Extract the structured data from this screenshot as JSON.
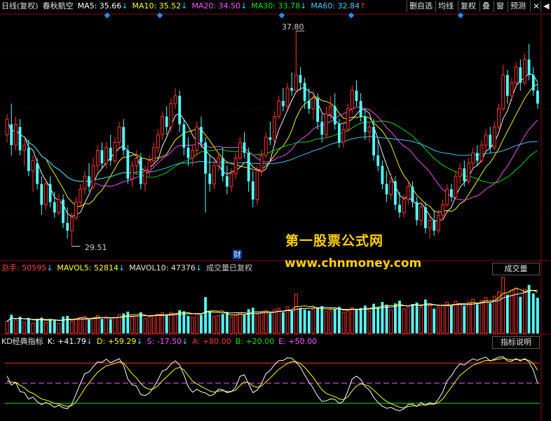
{
  "header": {
    "period": "日线(复权)",
    "stock_name": "春秋航空",
    "ma": [
      {
        "label": "MA5: 35.66",
        "arrow": "↓",
        "color": "#ffffff",
        "arrow_color": "#00d8ff"
      },
      {
        "label": "MA10: 35.52",
        "arrow": "↓",
        "color": "#ffff00",
        "arrow_color": "#00d8ff"
      },
      {
        "label": "MA20: 34.50",
        "arrow": "↓",
        "color": "#ff55ff",
        "arrow_color": "#00d8ff"
      },
      {
        "label": "MA30: 33.78",
        "arrow": "↓",
        "color": "#00e000",
        "arrow_color": "#00d8ff"
      },
      {
        "label": "MA60: 32.84",
        "arrow": "↑",
        "color": "#44ccff",
        "arrow_color": "#ff3030"
      }
    ],
    "toolbar": [
      "删自选",
      "均线",
      "复权",
      "叠",
      "窗",
      "预测"
    ],
    "close_icon": "close-icon",
    "back_icon": "arrow-left-icon"
  },
  "main_chart": {
    "high_label": "37.80",
    "low_label": "29.51",
    "event_marker": "财",
    "watermark_title": "第一股票公式网",
    "watermark_url": "www.chnmoney.com"
  },
  "volume_panel": {
    "total_label": "总手: 50595",
    "total_arrow": "↓",
    "mavol5": "MAVOL5: 52814",
    "mavol5_arrow": "↓",
    "mavol10": "MAVOL10: 47376",
    "mavol10_arrow": "↓",
    "note": "成交量已复权",
    "button": "成交量"
  },
  "kd_panel": {
    "name": "KD经典指标",
    "k": "K: +41.79",
    "k_arrow": "↓",
    "d": "D: +59.29",
    "d_arrow": "↓",
    "s": "S: -17.50",
    "s_arrow": "↓",
    "a": "A: +80.00",
    "b": "B: +20.00",
    "e": "E: +50.00",
    "button": "指标说明",
    "colors": {
      "k": "#ffffff",
      "d": "#ffff00",
      "s": "#ff55ff",
      "a": "#ff3030",
      "b": "#00e000",
      "e": "#ff55ff"
    }
  },
  "chart_data": {
    "type": "candlestick",
    "price_range": [
      29.0,
      38.4
    ],
    "ohlc": [
      [
        33.8,
        34.6,
        33.5,
        34.4
      ],
      [
        34.2,
        35.0,
        33.0,
        33.4
      ],
      [
        33.4,
        34.5,
        33.2,
        34.2
      ],
      [
        34.1,
        34.4,
        33.0,
        33.2
      ],
      [
        33.2,
        33.6,
        32.6,
        33.4
      ],
      [
        33.3,
        33.6,
        32.2,
        32.4
      ],
      [
        32.4,
        33.0,
        31.6,
        32.8
      ],
      [
        32.7,
        32.9,
        31.7,
        31.9
      ],
      [
        31.9,
        32.2,
        30.7,
        31.1
      ],
      [
        31.1,
        32.1,
        30.9,
        31.9
      ],
      [
        31.9,
        32.2,
        31.0,
        31.2
      ],
      [
        31.2,
        31.6,
        30.6,
        30.8
      ],
      [
        30.8,
        31.5,
        30.7,
        31.3
      ],
      [
        31.3,
        31.5,
        30.2,
        30.4
      ],
      [
        30.4,
        31.0,
        29.8,
        30.1
      ],
      [
        30.1,
        30.8,
        29.5,
        30.6
      ],
      [
        30.6,
        31.4,
        30.5,
        31.2
      ],
      [
        31.2,
        31.9,
        31.0,
        31.7
      ],
      [
        31.7,
        32.4,
        31.5,
        32.2
      ],
      [
        32.2,
        32.7,
        31.6,
        31.8
      ],
      [
        31.8,
        32.9,
        31.7,
        32.6
      ],
      [
        32.6,
        33.4,
        32.4,
        33.2
      ],
      [
        33.2,
        33.5,
        32.5,
        32.7
      ],
      [
        32.7,
        33.5,
        32.5,
        33.3
      ],
      [
        33.3,
        33.8,
        32.6,
        32.8
      ],
      [
        32.8,
        33.7,
        32.7,
        33.5
      ],
      [
        33.5,
        34.3,
        33.3,
        34.1
      ],
      [
        34.1,
        34.4,
        33.0,
        33.2
      ],
      [
        33.2,
        33.4,
        31.9,
        32.1
      ],
      [
        32.1,
        32.8,
        31.8,
        32.6
      ],
      [
        32.6,
        33.2,
        32.3,
        32.9
      ],
      [
        32.9,
        33.1,
        31.7,
        31.9
      ],
      [
        31.9,
        32.6,
        31.6,
        32.4
      ],
      [
        32.4,
        33.0,
        32.2,
        32.8
      ],
      [
        32.8,
        33.5,
        32.6,
        33.3
      ],
      [
        33.3,
        34.0,
        33.1,
        33.8
      ],
      [
        33.8,
        34.7,
        33.6,
        34.5
      ],
      [
        34.5,
        34.9,
        33.8,
        34.1
      ],
      [
        34.1,
        35.2,
        33.9,
        35.0
      ],
      [
        35.0,
        35.6,
        34.8,
        35.3
      ],
      [
        35.3,
        35.5,
        33.9,
        34.2
      ],
      [
        34.2,
        34.4,
        33.0,
        33.3
      ],
      [
        33.3,
        33.7,
        32.6,
        32.9
      ],
      [
        32.9,
        33.4,
        32.6,
        33.2
      ],
      [
        33.2,
        34.3,
        33.0,
        34.1
      ],
      [
        34.1,
        34.5,
        33.3,
        33.5
      ],
      [
        33.5,
        33.7,
        30.8,
        32.3
      ],
      [
        32.3,
        33.0,
        31.6,
        31.9
      ],
      [
        31.9,
        32.8,
        31.7,
        32.6
      ],
      [
        32.6,
        33.1,
        32.4,
        32.9
      ],
      [
        32.9,
        33.3,
        32.0,
        32.2
      ],
      [
        32.2,
        32.6,
        31.5,
        31.8
      ],
      [
        31.8,
        32.5,
        31.6,
        32.3
      ],
      [
        32.3,
        33.1,
        32.1,
        32.9
      ],
      [
        32.9,
        33.7,
        32.8,
        33.5
      ],
      [
        33.5,
        33.9,
        32.9,
        33.1
      ],
      [
        33.1,
        33.3,
        31.6,
        32.0
      ],
      [
        32.0,
        32.4,
        31.0,
        31.3
      ],
      [
        31.3,
        32.6,
        31.1,
        32.4
      ],
      [
        32.4,
        33.2,
        32.2,
        33.0
      ],
      [
        33.0,
        33.9,
        32.9,
        33.7
      ],
      [
        33.7,
        34.3,
        33.4,
        33.6
      ],
      [
        33.6,
        34.7,
        33.5,
        34.5
      ],
      [
        34.5,
        35.3,
        34.4,
        35.1
      ],
      [
        35.1,
        35.6,
        34.7,
        34.9
      ],
      [
        34.9,
        35.8,
        34.8,
        35.6
      ],
      [
        35.6,
        36.2,
        35.3,
        35.5
      ],
      [
        35.5,
        37.8,
        35.4,
        36.1
      ],
      [
        36.1,
        36.4,
        35.5,
        35.8
      ],
      [
        35.8,
        36.0,
        34.8,
        35.1
      ],
      [
        35.1,
        35.6,
        34.6,
        34.8
      ],
      [
        34.8,
        35.5,
        34.4,
        35.2
      ],
      [
        35.2,
        35.4,
        34.0,
        34.3
      ],
      [
        34.3,
        34.6,
        33.5,
        33.8
      ],
      [
        33.8,
        34.9,
        33.7,
        34.6
      ],
      [
        34.6,
        35.3,
        34.4,
        34.9
      ],
      [
        34.9,
        35.4,
        34.0,
        34.2
      ],
      [
        34.2,
        34.4,
        33.3,
        33.5
      ],
      [
        33.5,
        34.2,
        33.3,
        34.0
      ],
      [
        34.0,
        35.0,
        33.9,
        34.8
      ],
      [
        34.8,
        35.7,
        34.6,
        35.5
      ],
      [
        35.5,
        35.9,
        34.9,
        35.1
      ],
      [
        35.1,
        35.4,
        34.3,
        34.5
      ],
      [
        34.5,
        34.8,
        33.6,
        33.9
      ],
      [
        33.9,
        34.3,
        33.5,
        34.1
      ],
      [
        34.1,
        34.4,
        32.8,
        33.0
      ],
      [
        33.0,
        33.6,
        32.4,
        32.6
      ],
      [
        32.6,
        32.8,
        31.7,
        31.9
      ],
      [
        31.9,
        32.4,
        31.2,
        31.5
      ],
      [
        31.5,
        32.3,
        31.3,
        32.0
      ],
      [
        32.0,
        32.2,
        30.9,
        31.1
      ],
      [
        31.1,
        31.6,
        30.6,
        30.8
      ],
      [
        30.8,
        31.5,
        30.6,
        31.3
      ],
      [
        31.3,
        32.0,
        31.1,
        31.8
      ],
      [
        31.8,
        32.0,
        31.0,
        31.2
      ],
      [
        31.2,
        31.4,
        30.3,
        30.5
      ],
      [
        30.5,
        31.2,
        30.3,
        31.0
      ],
      [
        31.0,
        31.2,
        30.0,
        30.2
      ],
      [
        30.2,
        30.7,
        29.8,
        30.5
      ],
      [
        30.5,
        30.9,
        29.9,
        30.1
      ],
      [
        30.1,
        30.9,
        30.0,
        30.7
      ],
      [
        30.7,
        31.3,
        30.5,
        31.1
      ],
      [
        31.1,
        31.9,
        31.0,
        31.7
      ],
      [
        31.7,
        31.9,
        31.2,
        31.4
      ],
      [
        31.4,
        32.4,
        31.3,
        32.2
      ],
      [
        32.2,
        32.7,
        31.9,
        32.5
      ],
      [
        32.5,
        32.8,
        31.8,
        32.0
      ],
      [
        32.0,
        32.9,
        31.9,
        32.7
      ],
      [
        32.7,
        33.3,
        32.5,
        33.1
      ],
      [
        33.1,
        33.4,
        32.6,
        32.8
      ],
      [
        32.8,
        33.6,
        32.7,
        33.4
      ],
      [
        33.4,
        34.0,
        33.2,
        33.8
      ],
      [
        33.8,
        34.1,
        33.1,
        33.3
      ],
      [
        33.3,
        34.3,
        33.2,
        34.1
      ],
      [
        34.1,
        35.0,
        34.0,
        34.8
      ],
      [
        34.8,
        36.5,
        34.7,
        36.1
      ],
      [
        36.1,
        36.3,
        35.0,
        35.3
      ],
      [
        35.3,
        36.0,
        35.1,
        35.8
      ],
      [
        35.8,
        36.6,
        35.6,
        36.4
      ],
      [
        36.4,
        36.7,
        35.5,
        35.8
      ],
      [
        35.8,
        36.9,
        35.7,
        36.7
      ],
      [
        36.7,
        37.3,
        35.9,
        36.1
      ],
      [
        36.1,
        36.4,
        35.3,
        35.5
      ],
      [
        35.5,
        35.8,
        34.8,
        35.0
      ]
    ],
    "volume": [
      40,
      62,
      45,
      55,
      38,
      50,
      34,
      48,
      52,
      36,
      47,
      44,
      33,
      56,
      58,
      41,
      49,
      53,
      57,
      46,
      51,
      60,
      48,
      55,
      47,
      52,
      62,
      66,
      72,
      54,
      58,
      70,
      49,
      56,
      59,
      63,
      68,
      61,
      70,
      65,
      77,
      73,
      58,
      53,
      66,
      60,
      120,
      72,
      56,
      59,
      64,
      71,
      55,
      60,
      68,
      62,
      80,
      85,
      64,
      69,
      73,
      66,
      78,
      83,
      70,
      88,
      74,
      130,
      84,
      79,
      75,
      81,
      86,
      90,
      72,
      76,
      80,
      88,
      70,
      74,
      85,
      79,
      84,
      92,
      74,
      98,
      86,
      104,
      95,
      78,
      99,
      108,
      81,
      88,
      97,
      102,
      87,
      112,
      93,
      82,
      86,
      94,
      103,
      92,
      106,
      98,
      91,
      104,
      112,
      96,
      109,
      118,
      100,
      123,
      137,
      185,
      128,
      142,
      150,
      121,
      146,
      160,
      132,
      118
    ],
    "kd_lines": [
      "K",
      "D"
    ],
    "kd_levels": {
      "A": 80,
      "B": 20,
      "E": 50
    }
  }
}
